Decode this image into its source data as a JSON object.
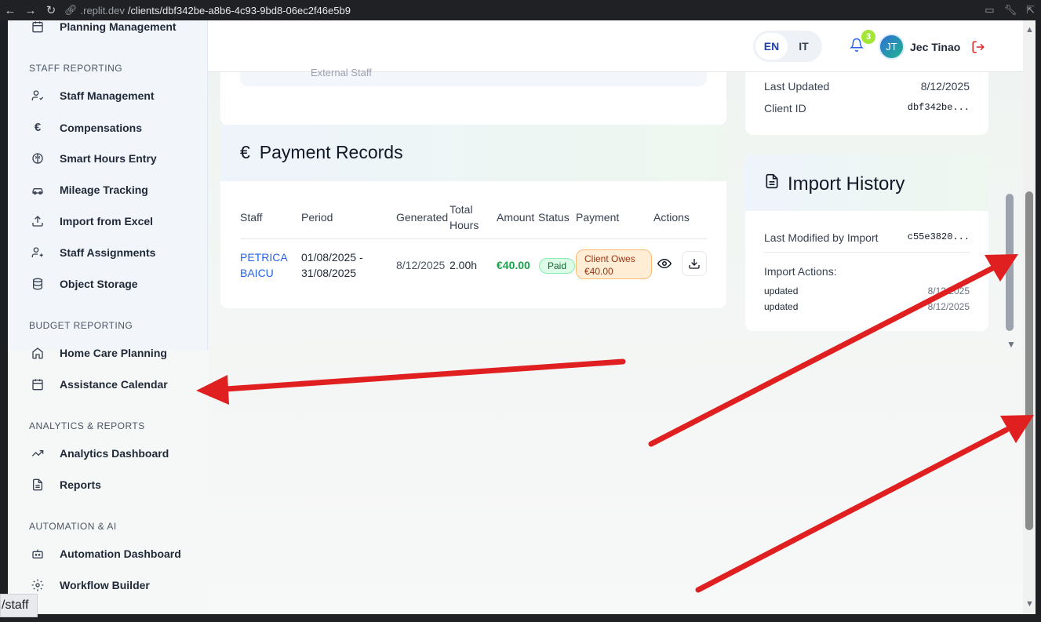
{
  "browser": {
    "url_host": ".replit.dev",
    "url_path": "/clients/dbf342be-a8b6-4c93-9bd8-06ec2f46e5b9"
  },
  "sidebar": {
    "top_item": "Planning Management",
    "sections": [
      {
        "label": "STAFF REPORTING",
        "items": [
          "Staff Management",
          "Compensations",
          "Smart Hours Entry",
          "Mileage Tracking",
          "Import from Excel",
          "Staff Assignments",
          "Object Storage"
        ]
      },
      {
        "label": "BUDGET REPORTING",
        "items": [
          "Home Care Planning",
          "Assistance Calendar"
        ]
      },
      {
        "label": "ANALYTICS & REPORTS",
        "items": [
          "Analytics Dashboard",
          "Reports"
        ]
      },
      {
        "label": "AUTOMATION & AI",
        "items": [
          "Automation Dashboard",
          "Workflow Builder"
        ]
      }
    ]
  },
  "header": {
    "lang_en": "EN",
    "lang_it": "IT",
    "notification_count": "3",
    "avatar_initials": "JT",
    "user_name": "Jec Tinao"
  },
  "top_card": {
    "faint_text": "External Staff"
  },
  "payment_records": {
    "title": "Payment Records",
    "columns": [
      "Staff",
      "Period",
      "Generated",
      "Total Hours",
      "Amount",
      "Status",
      "Payment",
      "Actions"
    ],
    "rows": [
      {
        "staff_line1": "PETRICA",
        "staff_line2": "BAICU",
        "period_line1": "01/08/2025 -",
        "period_line2": "31/08/2025",
        "generated": "8/12/2025",
        "total_hours": "2.00h",
        "amount": "€40.00",
        "status": "Paid",
        "payment_line1": "Client Owes",
        "payment_line2": "€40.00"
      }
    ]
  },
  "client_meta": {
    "last_updated_label": "Last Updated",
    "last_updated_value": "8/12/2025",
    "client_id_label": "Client ID",
    "client_id_value": "dbf342be..."
  },
  "import_history": {
    "title": "Import History",
    "last_modified_label": "Last Modified by Import",
    "last_modified_value": "c55e3820...",
    "actions_label": "Import Actions:",
    "actions": [
      {
        "action": "updated",
        "date": "8/12/2025"
      },
      {
        "action": "updated",
        "date": "8/12/2025"
      }
    ]
  },
  "status_tooltip": "/staff",
  "colors": {
    "accent_blue": "#2563eb",
    "amount_green": "#16a34a",
    "arrow_red": "#e02020",
    "logout_red": "#dc2626"
  }
}
